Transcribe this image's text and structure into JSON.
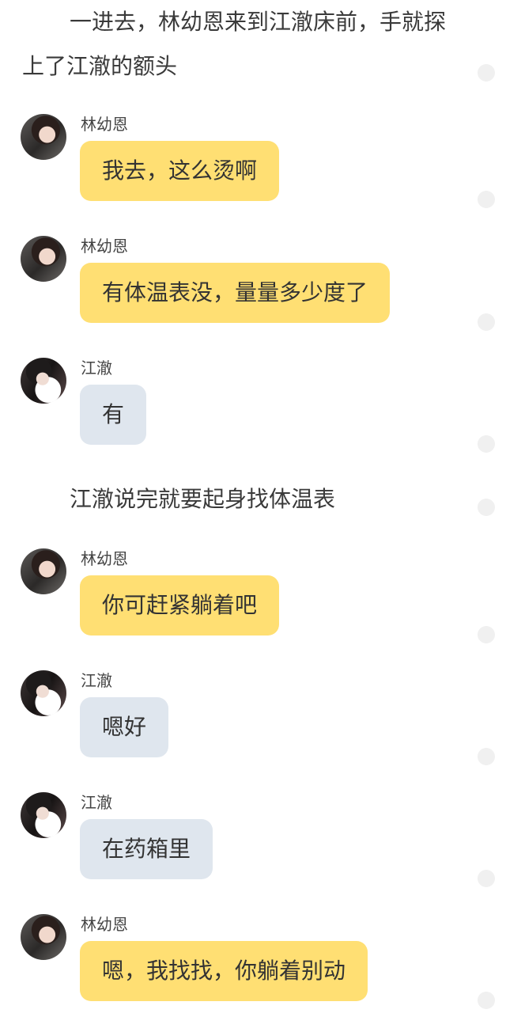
{
  "narration": [
    "一进去，林幼恩来到江澈床前，手就探上了江澈的额头",
    "江澈说完就要起身找体温表"
  ],
  "messages": [
    {
      "speaker": "林幼恩",
      "text": "我去，这么烫啊",
      "avatar": "lin-avatar"
    },
    {
      "speaker": "林幼恩",
      "text": "有体温表没，量量多少度了",
      "avatar": "lin-avatar"
    },
    {
      "speaker": "江澈",
      "text": "有",
      "avatar": "jiang-avatar"
    },
    {
      "speaker": "林幼恩",
      "text": "你可赶紧躺着吧",
      "avatar": "lin-avatar"
    },
    {
      "speaker": "江澈",
      "text": "嗯好",
      "avatar": "jiang-avatar"
    },
    {
      "speaker": "江澈",
      "text": "在药箱里",
      "avatar": "jiang-avatar"
    },
    {
      "speaker": "林幼恩",
      "text": "嗯，我找找，你躺着别动",
      "avatar": "lin-avatar"
    }
  ],
  "colors": {
    "lin_bubble": "#ffdf73",
    "jiang_bubble": "#dfe6ee",
    "dot": "#f0f0f0"
  }
}
